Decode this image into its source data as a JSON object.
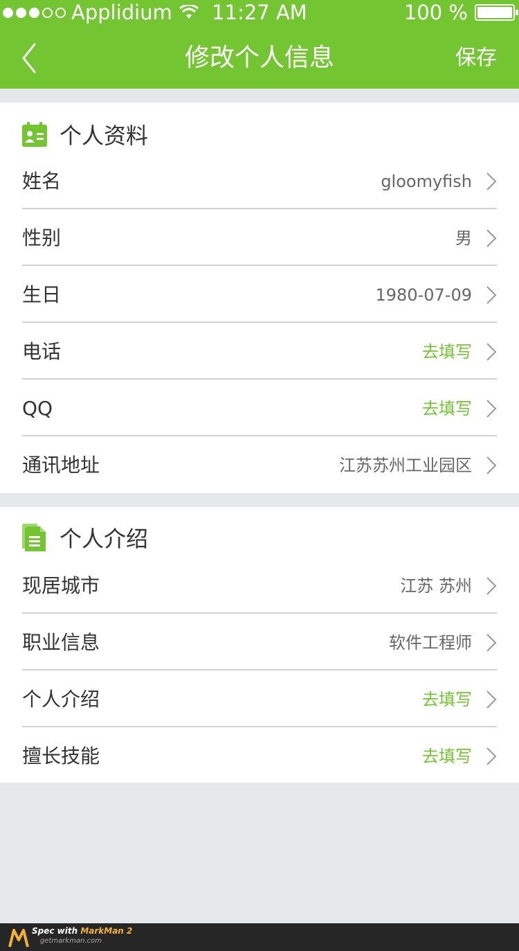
{
  "status_bar": {
    "carrier": "Applidium",
    "time": "11:27 AM",
    "battery": "100 %",
    "signal_dots_filled": 3,
    "signal_dots_total": 5
  },
  "nav": {
    "title": "修改个人信息",
    "save_label": "保存",
    "back_icon": "chevron-left-icon"
  },
  "colors": {
    "header_bg": "#73c631",
    "page_bg": "#e5e8ea",
    "card_bg": "#ffffff",
    "label": "#333333",
    "value": "#666666",
    "accent_value": "#72c630",
    "divider": "#d2d2d2"
  },
  "section_profile": {
    "title": "个人资料",
    "icon": "contact-card-icon",
    "rows": [
      {
        "label": "姓名",
        "value": "gloomyfish",
        "filled": true
      },
      {
        "label": "性别",
        "value": "男",
        "filled": true
      },
      {
        "label": "生日",
        "value": "1980-07-09",
        "filled": true
      },
      {
        "label": "电话",
        "value": "去填写",
        "filled": false
      },
      {
        "label": "QQ",
        "value": "去填写",
        "filled": false
      },
      {
        "label": "通讯地址",
        "value": "江苏苏州工业园区",
        "filled": true
      }
    ]
  },
  "section_intro": {
    "title": "个人介绍",
    "icon": "document-icon",
    "rows": [
      {
        "label": "现居城市",
        "value": "江苏 苏州",
        "filled": true
      },
      {
        "label": "职业信息",
        "value": "软件工程师",
        "filled": true
      },
      {
        "label": "个人介绍",
        "value": "去填写",
        "filled": false
      },
      {
        "label": "擅长技能",
        "value": "去填写",
        "filled": false
      }
    ]
  },
  "watermark": {
    "line1_prefix": "Spec with ",
    "line1_brand": "MarkMan 2",
    "line2": "getmarkman.com"
  }
}
